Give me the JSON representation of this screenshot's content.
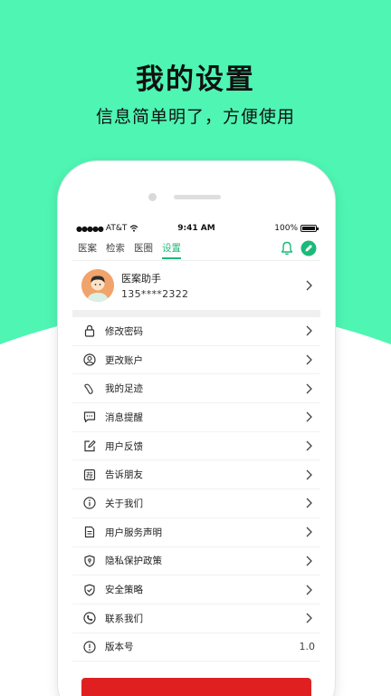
{
  "hero": {
    "title": "我的设置",
    "subtitle": "信息简单明了，方便使用"
  },
  "colors": {
    "background_accent": "#4ef5b3",
    "tab_active": "#1db97a",
    "danger_button": "#e02020"
  },
  "status_bar": {
    "carrier": "AT&T",
    "time": "9:41 AM",
    "battery": "100%",
    "battery_level": 1.0
  },
  "nav": {
    "tabs": [
      {
        "label": "医案",
        "active": false
      },
      {
        "label": "检索",
        "active": false
      },
      {
        "label": "医圈",
        "active": false
      },
      {
        "label": "设置",
        "active": true
      }
    ],
    "icons": [
      "bell-icon",
      "edit-icon"
    ]
  },
  "profile": {
    "name": "医案助手",
    "phone": "135****2322"
  },
  "menu": [
    {
      "icon": "lock-icon",
      "label": "修改密码"
    },
    {
      "icon": "user-circle-icon",
      "label": "更改账户"
    },
    {
      "icon": "footprint-icon",
      "label": "我的足迹"
    },
    {
      "icon": "message-icon",
      "label": "消息提醒"
    },
    {
      "icon": "feedback-icon",
      "label": "用户反馈"
    },
    {
      "icon": "recommend-icon",
      "label": "告诉朋友"
    },
    {
      "icon": "info-icon",
      "label": "关于我们"
    },
    {
      "icon": "document-icon",
      "label": "用户服务声明"
    },
    {
      "icon": "shield-icon",
      "label": "隐私保护政策"
    },
    {
      "icon": "shield-check-icon",
      "label": "安全策略"
    },
    {
      "icon": "phone-icon",
      "label": "联系我们"
    },
    {
      "icon": "alert-icon",
      "label": "版本号",
      "value": "1.0"
    }
  ]
}
